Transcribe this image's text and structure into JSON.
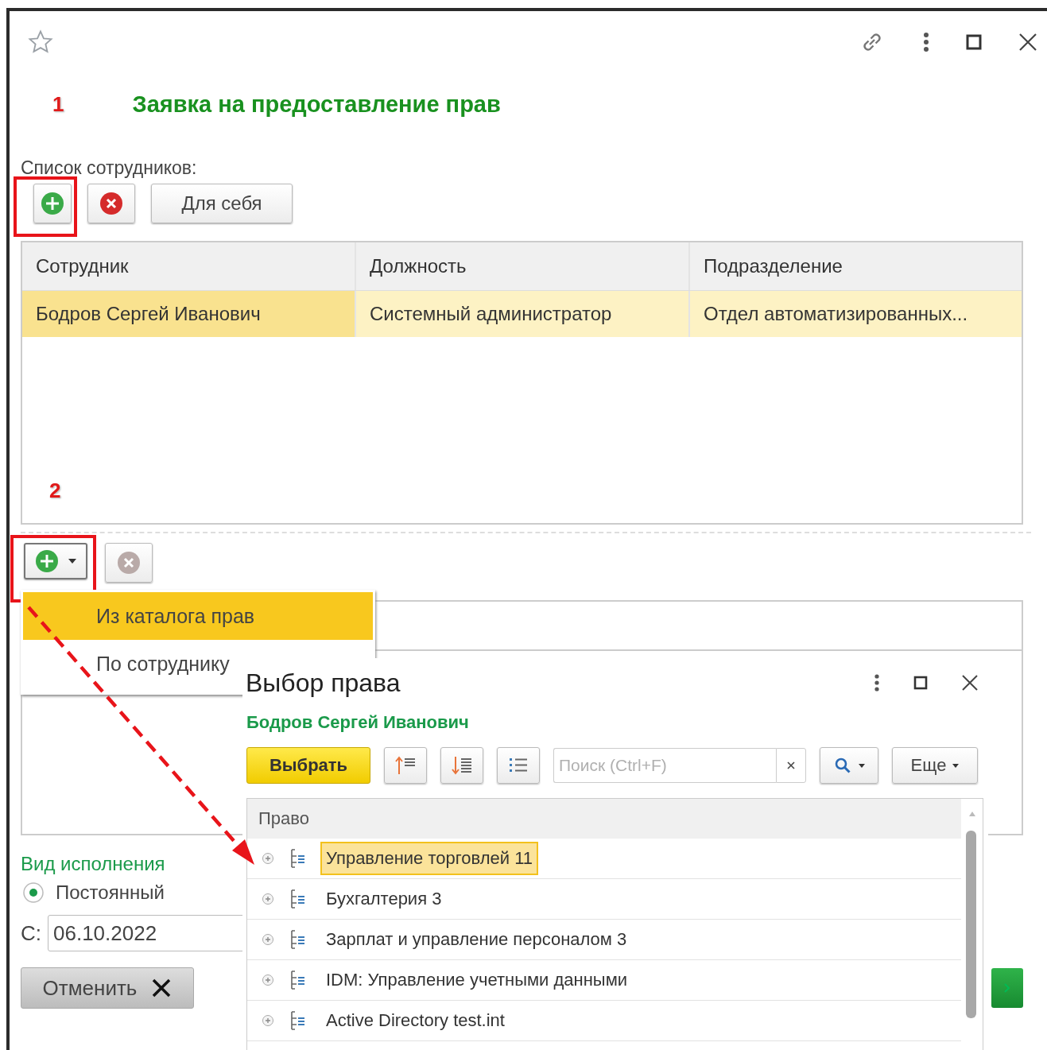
{
  "window": {
    "title": "Заявка на предоставление прав",
    "favorite": false
  },
  "annotations": [
    {
      "label": "1"
    },
    {
      "label": "2"
    }
  ],
  "employees": {
    "label": "Список сотрудников:",
    "delete_disabled": false,
    "self_button": "Для себя",
    "columns": [
      "Сотрудник",
      "Должность",
      "Подразделение"
    ],
    "rows": [
      {
        "cells": [
          "Бодров Сергей Иванович",
          "Системный администратор",
          "Отдел автоматизированных..."
        ],
        "selected": true
      }
    ]
  },
  "rights_toolbar": {
    "delete_disabled": true
  },
  "add_menu": {
    "items": [
      {
        "label": "Из каталога прав",
        "selected": true
      },
      {
        "label": "По сотруднику",
        "selected": false
      }
    ]
  },
  "execution": {
    "label": "Вид исполнения",
    "options": [
      {
        "label": "Постоянный",
        "selected": true
      }
    ],
    "from_label": "С:",
    "from_date": "06.10.2022"
  },
  "cancel_button": "Отменить",
  "dialog": {
    "title": "Выбор права",
    "subtitle": "Бодров Сергей Иванович",
    "select_button": "Выбрать",
    "search_placeholder": "Поиск (Ctrl+F)",
    "more_button": "Еще",
    "column": "Право",
    "rows": [
      {
        "label": "Управление торговлей 11",
        "selected": true,
        "expanded": false
      },
      {
        "label": "Бухгалтерия 3",
        "selected": false,
        "expanded": false
      },
      {
        "label": "Зарплат и управление персоналом 3",
        "selected": false,
        "expanded": false
      },
      {
        "label": "IDM: Управление учетными данными",
        "selected": false,
        "expanded": false
      },
      {
        "label": "Active Directory test.int",
        "selected": false,
        "expanded": false
      }
    ]
  }
}
